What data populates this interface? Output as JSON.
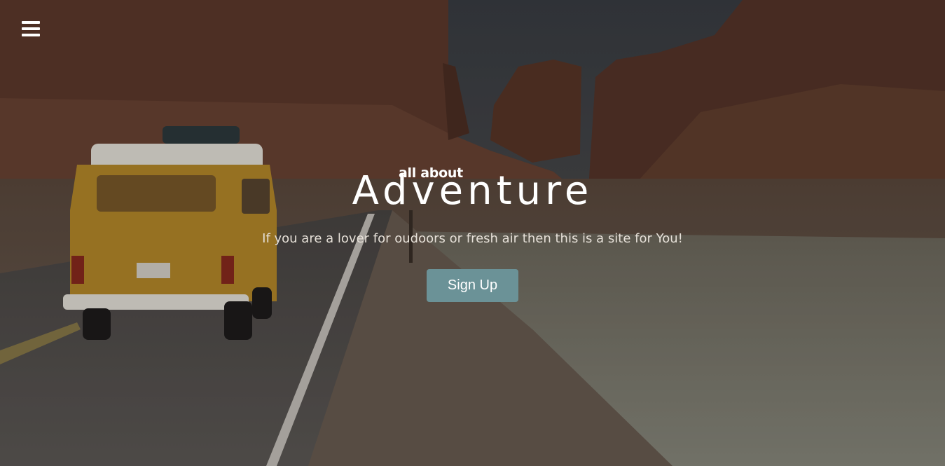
{
  "header": {
    "menu_icon": "hamburger-menu-icon"
  },
  "hero": {
    "tagline_small": "all about",
    "headline": "Adventure",
    "subtitle": "If you are a lover for oudoors or fresh air then this is a site for You!",
    "signup_label": "Sign Up"
  },
  "colors": {
    "button_bg": "#6b9297",
    "text": "#ffffff"
  }
}
